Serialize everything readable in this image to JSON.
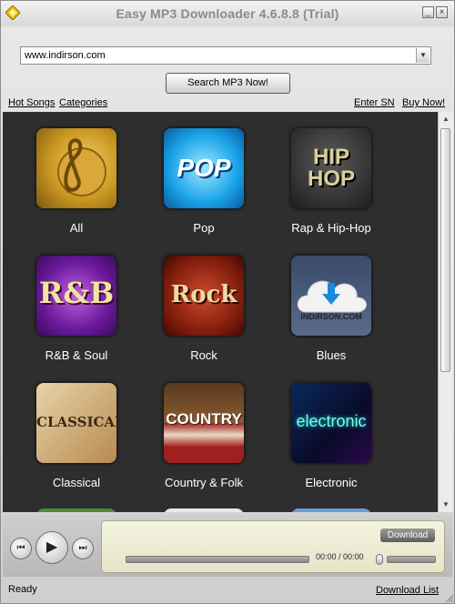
{
  "window": {
    "title": "Easy MP3 Downloader  4.6.8.8  (Trial)",
    "min_glyph": "_",
    "close_glyph": "×"
  },
  "search": {
    "url_value": "www.indirson.com",
    "button_label": "Search MP3 Now!"
  },
  "nav": {
    "hot_songs": "Hot Songs",
    "categories": "Categories",
    "enter_sn": "Enter SN",
    "buy_now": "Buy Now!"
  },
  "categories": [
    {
      "label": "All",
      "art_text": ""
    },
    {
      "label": "Pop",
      "art_text": "POP"
    },
    {
      "label": "Rap & Hip-Hop",
      "art_text": "HIP HOP"
    },
    {
      "label": "R&B & Soul",
      "art_text": "R&B"
    },
    {
      "label": "Rock",
      "art_text": "Rock"
    },
    {
      "label": "Blues",
      "art_text": "iNDiRSON.COM"
    },
    {
      "label": "Classical",
      "art_text": "CLASSICAL"
    },
    {
      "label": "Country & Folk",
      "art_text": "COUNTRY"
    },
    {
      "label": "Electronic",
      "art_text": "electronic"
    }
  ],
  "player": {
    "download_label": "Download",
    "time": "00:00 / 00:00",
    "seek_progress": 0,
    "volume": 1.0
  },
  "status": {
    "text": "Ready",
    "download_list": "Download List"
  },
  "colors": {
    "grid_bg": "#2e2e2e",
    "title_text": "#8a8a8a",
    "panel_bg": "#f0efd6"
  },
  "icons": [
    "app-diamond-icon",
    "minimize-icon",
    "close-icon",
    "dropdown-arrow-icon",
    "previous-icon",
    "play-icon",
    "next-icon",
    "volume-icon"
  ]
}
